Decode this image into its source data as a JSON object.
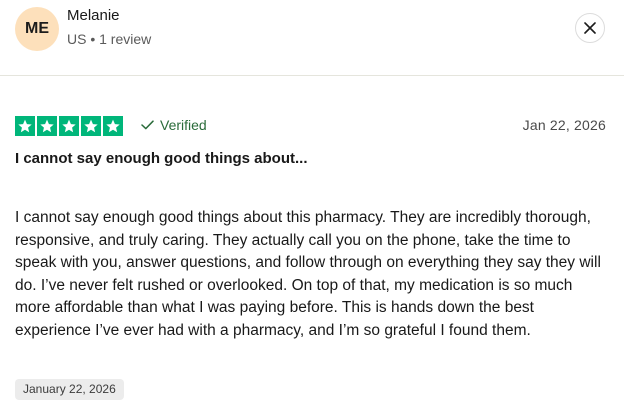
{
  "reviewer": {
    "initials": "ME",
    "name": "Melanie",
    "meta": "US • 1 review"
  },
  "review": {
    "rating": 5,
    "rating_max": 5,
    "verified_label": "Verified",
    "date": "Jan 22, 2026",
    "title": "I cannot say enough good things about...",
    "body": "I cannot say enough good things about this pharmacy. They are incredibly thorough, responsive, and truly caring. They actually call you on the phone, take the time to speak with you, answer questions, and follow through on everything they say they will do. I’ve never felt rushed or overlooked. On top of that, my medication is so much more affordable than what I was paying before. This is hands down the best experience I’ve ever had with a pharmacy, and I’m so grateful I found them.",
    "experience_date": "January 22, 2026"
  },
  "icons": {
    "close": "close-icon",
    "star": "star-icon",
    "verified": "check-icon"
  },
  "colors": {
    "star_green": "#00b67a",
    "avatar_bg": "#fde0bb",
    "verified_green": "#2a6b3a"
  }
}
